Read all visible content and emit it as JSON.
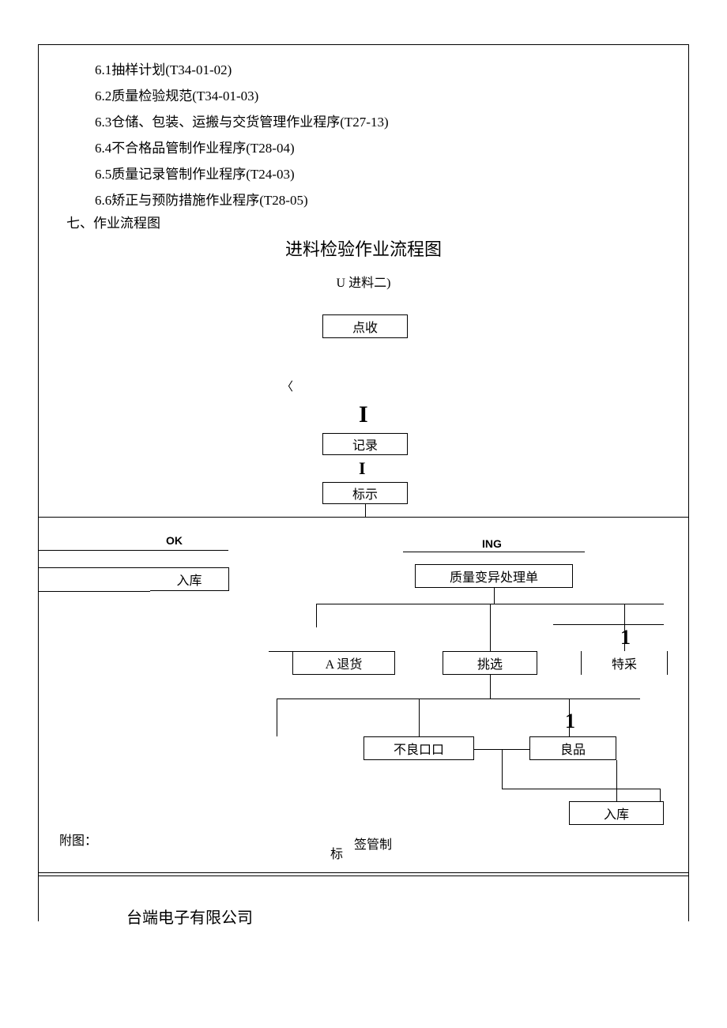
{
  "list": [
    "6.1抽样计划(T34-01-02)",
    "6.2质量检验规范(T34-01-03)",
    "6.3仓储、包装、运搬与交货管理作业程序(T27-13)",
    "6.4不合格品管制作业程序(T28-04)",
    "6.5质量记录管制作业程序(T24-03)",
    "6.6矫正与预防措施作业程序(T28-05)"
  ],
  "section7": "七、作业流程图",
  "title": "进料检验作业流程图",
  "subtitle": "U 进料二)",
  "nodes": {
    "dianshou": "点收",
    "jilu": "记录",
    "biaoshi": "标示",
    "ok": "OK",
    "ing": "ING",
    "ruku": "入库",
    "bianyi": "质量变异处理单",
    "tuihuo": "A 退货",
    "tiaoxuan": "挑选",
    "tecai": "特采",
    "buliang": "不良口口",
    "liangpin": "良品",
    "ruku2": "入库"
  },
  "markers": {
    "I1": "I",
    "I2": "I",
    "one1": "1",
    "one2": "1",
    "angle": "〈"
  },
  "footer": {
    "fujian": "附图：",
    "biao": "标",
    "qianguanzhi": "签管制",
    "company": "台端电子有限公司"
  }
}
